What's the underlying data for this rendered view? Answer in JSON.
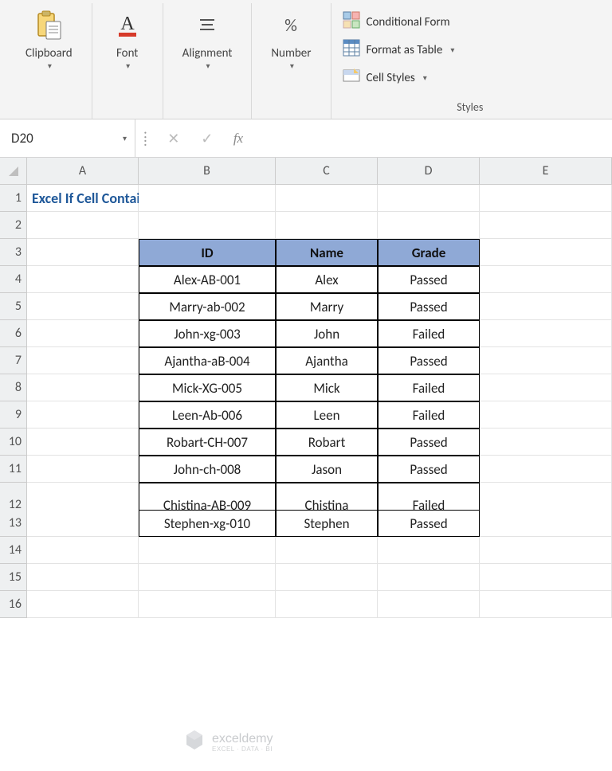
{
  "ribbon": {
    "groups": [
      {
        "label": "Clipboard"
      },
      {
        "label": "Font"
      },
      {
        "label": "Alignment"
      },
      {
        "label": "Number"
      }
    ],
    "styles": {
      "items": [
        "Conditional Form",
        "Format as Table",
        "Cell Styles"
      ],
      "label": "Styles"
    }
  },
  "namebox": "D20",
  "formula": "",
  "columns": [
    "A",
    "B",
    "C",
    "D",
    "E"
  ],
  "title": "Excel If Cell Contains Specific Text",
  "table": {
    "headers": [
      "ID",
      "Name",
      "Grade"
    ],
    "rows": [
      [
        "Alex-AB-001",
        "Alex",
        "Passed"
      ],
      [
        "Marry-ab-002",
        "Marry",
        "Passed"
      ],
      [
        "John-xg-003",
        "John",
        "Failed"
      ],
      [
        "Ajantha-aB-004",
        "Ajantha",
        "Passed"
      ],
      [
        "Mick-XG-005",
        "Mick",
        "Failed"
      ],
      [
        "Leen-Ab-006",
        "Leen",
        "Failed"
      ],
      [
        "Robart-CH-007",
        "Robart",
        "Passed"
      ],
      [
        "John-ch-008",
        "Jason",
        "Passed"
      ],
      [
        "Chistina-AB-009",
        "Chistina",
        "Failed"
      ],
      [
        "Stephen-xg-010",
        "Stephen",
        "Passed"
      ]
    ]
  },
  "watermark": {
    "brand": "exceldemy",
    "tagline": "EXCEL · DATA · BI"
  }
}
